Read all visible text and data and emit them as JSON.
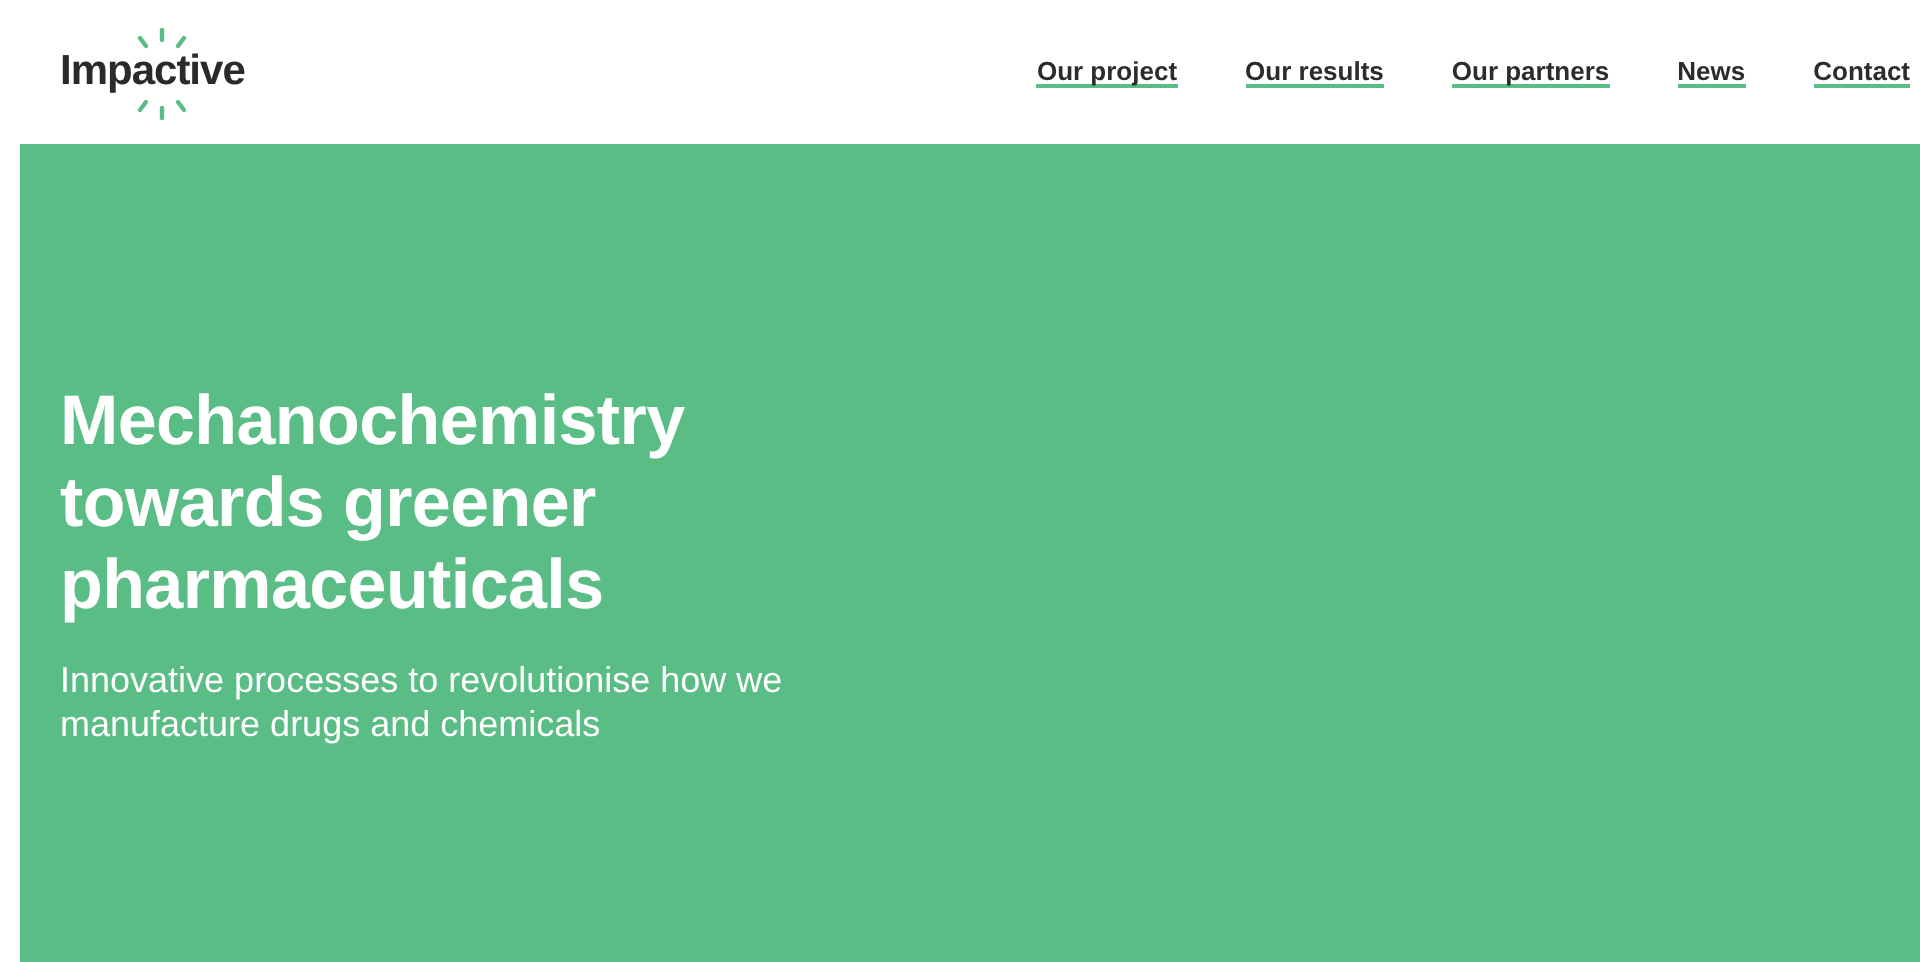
{
  "header": {
    "logo": "Impactive",
    "nav": [
      {
        "label": "Our project"
      },
      {
        "label": "Our results"
      },
      {
        "label": "Our partners"
      },
      {
        "label": "News"
      },
      {
        "label": "Contact"
      }
    ]
  },
  "hero": {
    "title": "Mechanochemistry towards greener pharmaceuticals",
    "subtitle": "Innovative processes to revolutionise how we manufacture drugs and chemicals"
  }
}
